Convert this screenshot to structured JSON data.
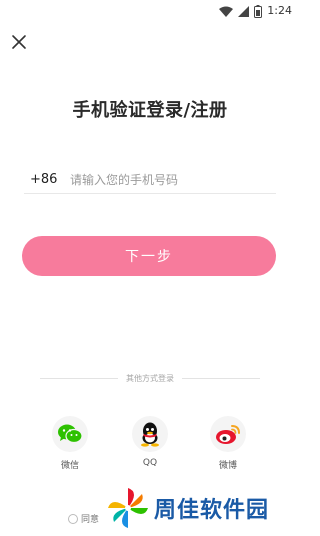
{
  "status_bar": {
    "time": "1:24",
    "icons": [
      "wifi-icon",
      "signal-icon",
      "battery-icon"
    ]
  },
  "header": {
    "close_icon": "close-icon",
    "title": "手机验证登录/注册"
  },
  "phone_form": {
    "country_code": "+86",
    "placeholder": "请输入您的手机号码",
    "value": ""
  },
  "next_button": {
    "label": "下一步",
    "color": "#f77b9c"
  },
  "other_login": {
    "divider_text": "其他方式登录",
    "options": [
      {
        "label": "微信",
        "icon": "wechat-icon",
        "color": "#2dc100"
      },
      {
        "label": "QQ",
        "icon": "qq-icon",
        "color": "#111111"
      },
      {
        "label": "微博",
        "icon": "weibo-icon",
        "color": "#e6162d"
      }
    ]
  },
  "agreement": {
    "text": "同意"
  },
  "watermark": {
    "text": "周佳软件园",
    "color": "#1a5aa6"
  }
}
